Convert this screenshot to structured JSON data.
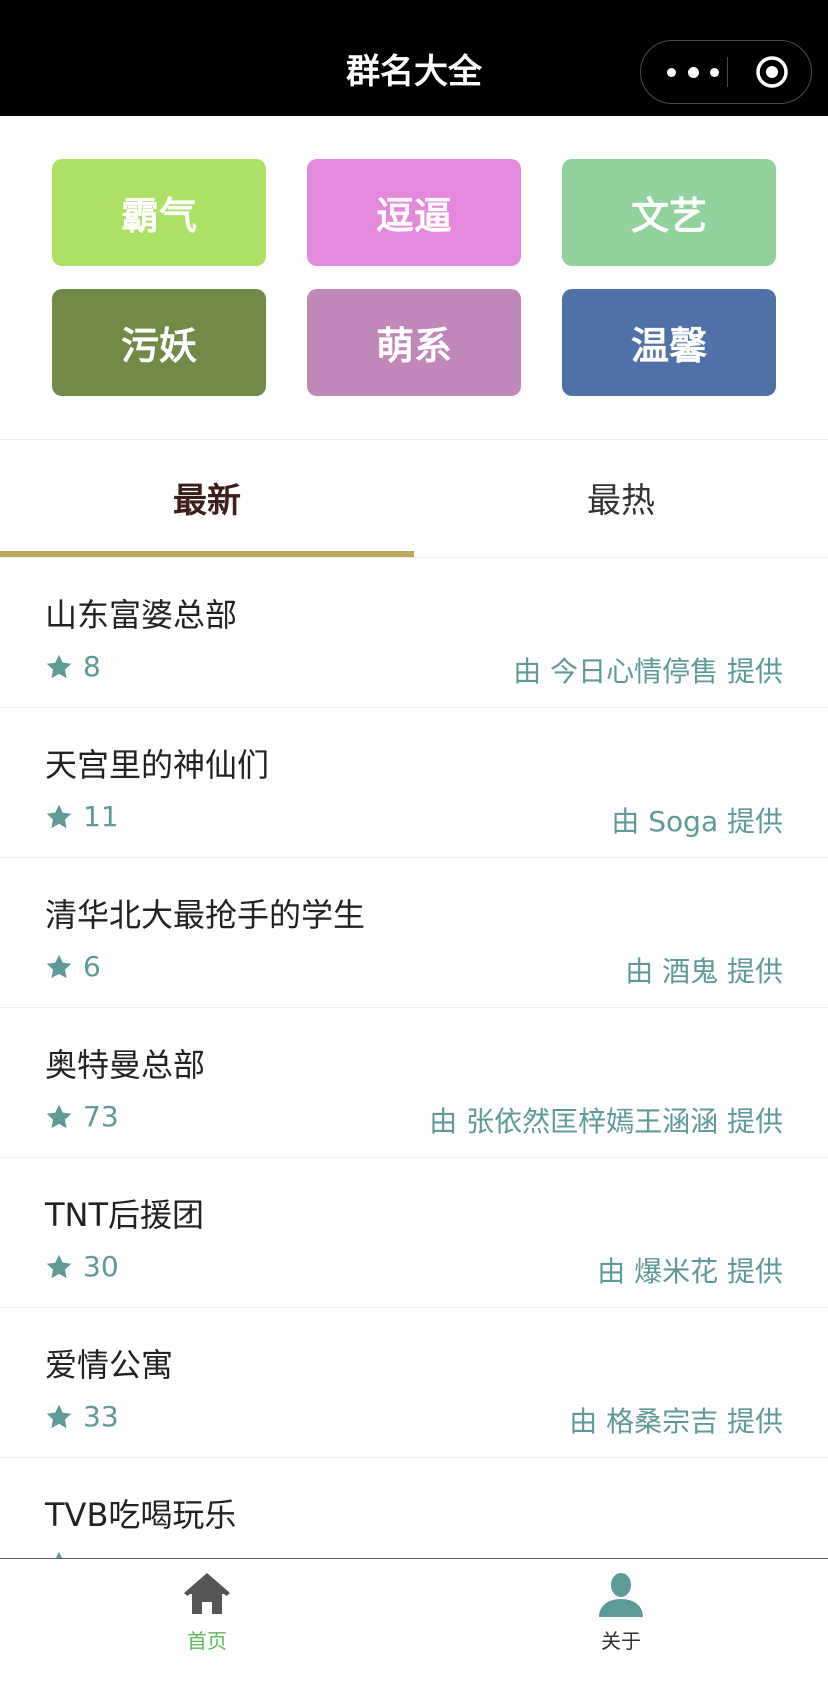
{
  "app": {
    "title": "群名大全"
  },
  "categories": [
    {
      "label": "霸气",
      "color": "#ade166"
    },
    {
      "label": "逗逼",
      "color": "#e589dd"
    },
    {
      "label": "文艺",
      "color": "#91d29c"
    },
    {
      "label": "污妖",
      "color": "#718a48"
    },
    {
      "label": "萌系",
      "color": "#bf88b8"
    },
    {
      "label": "温馨",
      "color": "#4e71a7"
    }
  ],
  "tabs": [
    {
      "label": "最新",
      "active": true
    },
    {
      "label": "最热",
      "active": false
    }
  ],
  "list": [
    {
      "name": "山东富婆总部",
      "count": "8",
      "provider": "由 今日心情停售 提供"
    },
    {
      "name": "天宫里的神仙们",
      "count": "11",
      "provider": "由 Soga 提供"
    },
    {
      "name": "清华北大最抢手的学生",
      "count": "6",
      "provider": "由 酒鬼 提供"
    },
    {
      "name": "奥特曼总部",
      "count": "73",
      "provider": "由 张依然匡梓嫣王涵涵 提供"
    },
    {
      "name": "TNT后援团",
      "count": "30",
      "provider": "由 爆米花 提供"
    },
    {
      "name": "爱情公寓",
      "count": "33",
      "provider": "由 格桑宗吉 提供"
    },
    {
      "name": "TVB吃喝玩乐",
      "count": "",
      "provider": ""
    }
  ],
  "bottom_nav": [
    {
      "label": "首页",
      "icon": "home-icon",
      "active": true,
      "color": "#5cb85c"
    },
    {
      "label": "关于",
      "icon": "user-icon",
      "active": false,
      "color": "#333333"
    }
  ],
  "colors": {
    "accent": "#5e9a97",
    "tab_indicator": "#b9a85a",
    "home_icon": "#555555",
    "user_icon": "#5e9a97"
  }
}
